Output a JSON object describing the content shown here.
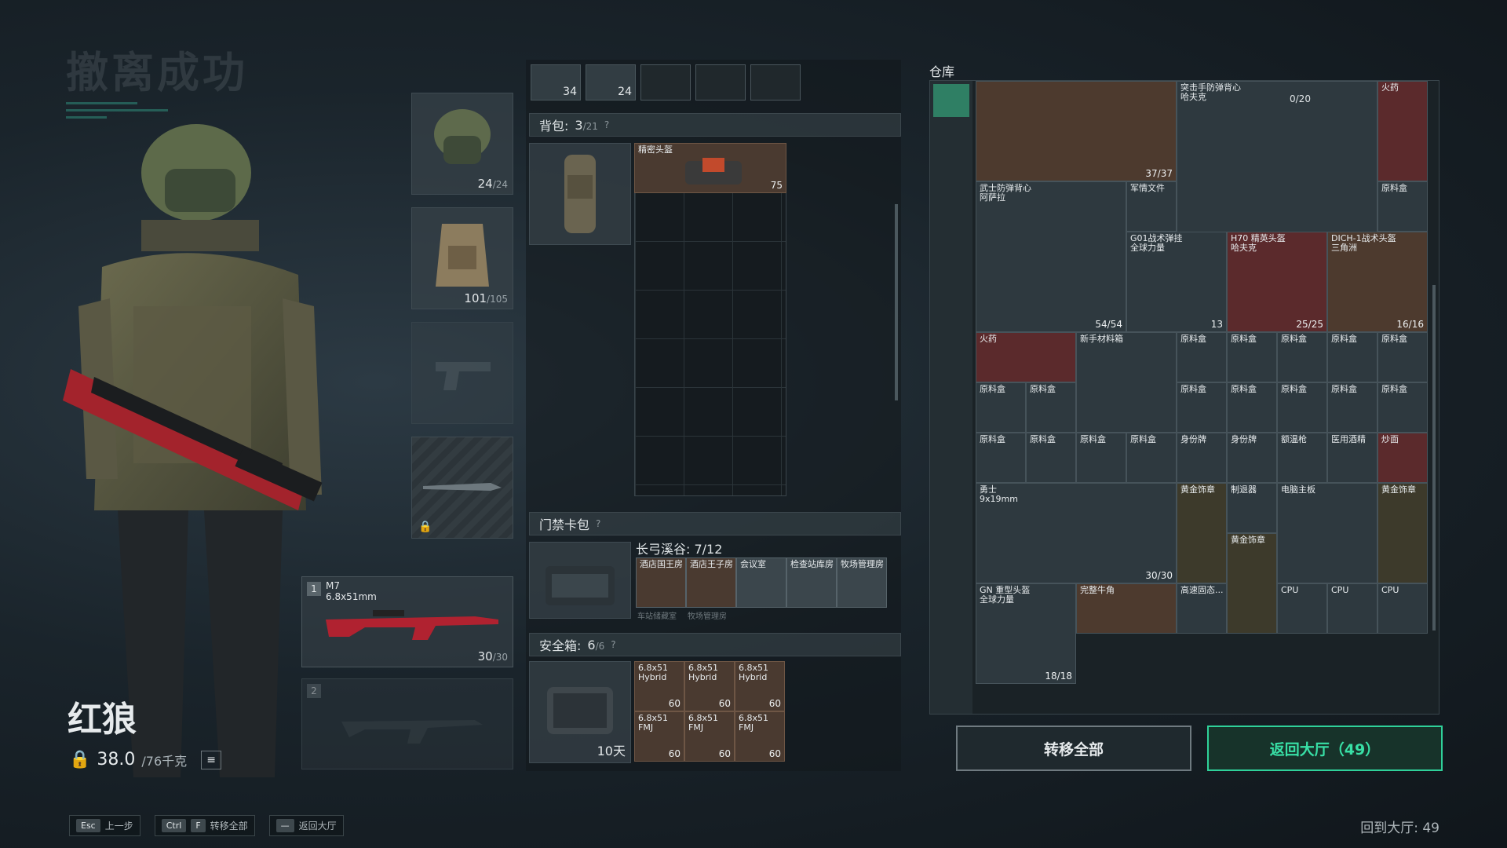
{
  "header": {
    "title": "撤离成功"
  },
  "character": {
    "name": "红狼",
    "weight_value": "38.0",
    "weight_unit": "/76千克"
  },
  "equipment": {
    "helmet_count": "24",
    "helmet_max": "/24",
    "armor_count": "101",
    "armor_max": "/105",
    "primary": {
      "slot": "1",
      "name": "M7",
      "ammo_type": "6.8x51mm",
      "ammo": "30",
      "ammo_max": "/30"
    },
    "secondary": {
      "slot": "2"
    }
  },
  "ammo_slots": [
    {
      "count": "34"
    },
    {
      "count": "24"
    }
  ],
  "backpack": {
    "label": "背包:",
    "value": "3",
    "max": "/21",
    "item": {
      "name": "精密头盔",
      "count": "75"
    }
  },
  "keycard": {
    "label": "门禁卡包",
    "location": "长弓溪谷: 7/12",
    "cards": [
      "酒店国王房",
      "酒店王子房",
      "会议室",
      "检查站库房",
      "牧场管理房"
    ],
    "sub_cards": [
      "车站储藏室",
      "牧场管理房"
    ]
  },
  "safebox": {
    "label": "安全箱:",
    "value": "6",
    "max": "/6",
    "timer": "10天",
    "items": [
      {
        "name": "6.8x51\nHybrid",
        "count": "60"
      },
      {
        "name": "6.8x51\nHybrid",
        "count": "60"
      },
      {
        "name": "6.8x51\nHybrid",
        "count": "60"
      },
      {
        "name": "6.8x51\nFMJ",
        "count": "60"
      },
      {
        "name": "6.8x51\nFMJ",
        "count": "60"
      },
      {
        "name": "6.8x51\nFMJ",
        "count": "60"
      }
    ]
  },
  "warehouse": {
    "title": "仓库",
    "top_counter": "0/20",
    "items": {
      "armor_big_count": "37/37",
      "vest_assault": "突击手防弹背心\n哈夫克",
      "vest_assault_count": "54/54",
      "gunpowder": "火药",
      "vest_warrior": "武士防弹背心\n阿萨拉",
      "vest_warrior_count": "54/54",
      "military_intel": "军情文件",
      "chest_rig": "G01战术弹挂\n全球力量",
      "chest_rig_count": "13",
      "helmet_h70": "H70 精英头盔\n哈夫克",
      "helmet_h70_count": "25/25",
      "helmet_dich": "DICH-1战术头盔\n三角洲",
      "helmet_dich_count": "16/16",
      "rookie_box": "新手材料箱",
      "raw_ore": "原料盒",
      "dog_tag": "身份牌",
      "thermometer": "额温枪",
      "alcohol": "医用酒精",
      "stir_fry": "炒面",
      "rifle": "勇士\n9x19mm",
      "rifle_count": "30/30",
      "gold_badge": "黄金饰章",
      "suppressor": "制退器",
      "motherboard": "电脑主板",
      "heavy_helmet": "GN 重型头盔\n全球力量",
      "heavy_helmet_count": "18/18",
      "horn": "完整牛角",
      "hs_cable": "高速固态...",
      "cpu": "CPU"
    }
  },
  "buttons": {
    "transfer_all": "转移全部",
    "back_to_hall": "返回大厅（49）"
  },
  "hints": [
    {
      "keys": [
        "Esc"
      ],
      "label": "上一步"
    },
    {
      "keys": [
        "Ctrl",
        "F"
      ],
      "label": "转移全部"
    },
    {
      "keys": [
        "—"
      ],
      "label": "返回大厅"
    }
  ],
  "footer": {
    "return_text": "回到大厅: 49"
  },
  "colors": {
    "accent": "#2fd19a",
    "panel": "#1a2226"
  }
}
